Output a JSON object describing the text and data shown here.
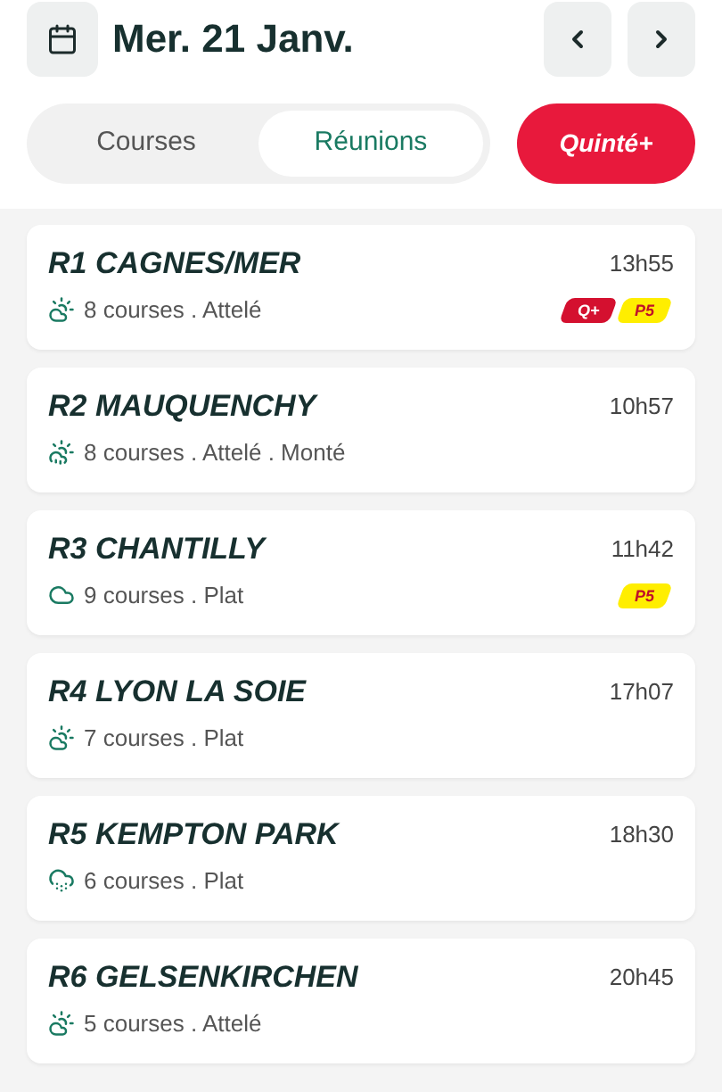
{
  "header": {
    "date": "Mer. 21 Janv."
  },
  "tabs": [
    {
      "label": "Courses",
      "selected": false
    },
    {
      "label": "Réunions",
      "selected": true
    }
  ],
  "quinte_button": "Quinté+",
  "meetings": [
    {
      "title": "R1 CAGNES/MER",
      "time": "13h55",
      "kind": "sun",
      "info": "8 courses . Attelé",
      "badges": [
        {
          "kind": "quinte",
          "text": "Q+"
        },
        {
          "kind": "pick5",
          "text": "P5"
        }
      ]
    },
    {
      "title": "R2 MAUQUENCHY",
      "time": "10h57",
      "kind": "shower",
      "info": "8 courses . Attelé . Monté"
    },
    {
      "title": "R3 CHANTILLY",
      "time": "11h42",
      "kind": "cloud",
      "info": "9 courses . Plat",
      "badges": [
        {
          "kind": "pick5",
          "text": "P5"
        }
      ]
    },
    {
      "title": "R4 LYON LA SOIE",
      "time": "17h07",
      "kind": "sun",
      "info": "7 courses . Plat"
    },
    {
      "title": "R5 KEMPTON PARK",
      "time": "18h30",
      "kind": "snow",
      "info": "6 courses . Plat"
    },
    {
      "title": "R6 GELSENKIRCHEN",
      "time": "20h45",
      "kind": "sun",
      "info": "5 courses . Attelé"
    }
  ]
}
